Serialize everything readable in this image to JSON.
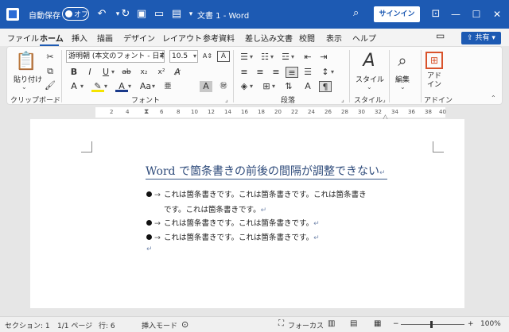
{
  "titlebar": {
    "autosave_label": "自動保存",
    "autosave_state": "オフ",
    "doc_title": "文書 1  -  Word",
    "signin_label": "サインイン",
    "icons": [
      "word-logo",
      "undo",
      "redo",
      "save",
      "new-doc",
      "open-folder",
      "customize",
      "search",
      "minimize",
      "maximize",
      "close"
    ]
  },
  "tabs": [
    "ファイル",
    "ホーム",
    "挿入",
    "描画",
    "デザイン",
    "レイアウト",
    "参考資料",
    "差し込み文書",
    "校閲",
    "表示",
    "ヘルプ"
  ],
  "active_tab": "ホーム",
  "share_label": "共有",
  "ribbon": {
    "clipboard": {
      "paste_label": "貼り付け",
      "group_label": "クリップボード"
    },
    "font": {
      "font_name": "游明朝 (本文のフォント - 日本語)",
      "font_size": "10.5",
      "group_label": "フォント",
      "buttons": [
        "B",
        "I",
        "U",
        "ab",
        "x₂",
        "x²",
        "A",
        "A",
        "A"
      ]
    },
    "paragraph": {
      "group_label": "段落"
    },
    "styles": {
      "style_label": "スタイル",
      "group_label": "スタイル"
    },
    "editing": {
      "edit_label": "編集"
    },
    "addin": {
      "addin_label": "アド\nイン",
      "group_label": "アドイン"
    }
  },
  "ruler": {
    "numbers": [
      "2",
      "4",
      "6",
      "8",
      "10",
      "12",
      "14",
      "16",
      "18",
      "20",
      "22",
      "24",
      "26",
      "28",
      "30",
      "32",
      "34",
      "36",
      "38",
      "40"
    ]
  },
  "document": {
    "title": "Word で箇条書きの前後の間隔が調整できない",
    "bullets": [
      {
        "line1": "これは箇条書きです。これは箇条書きです。これは箇条書き",
        "line2": "です。これは箇条書きです。"
      },
      {
        "line1": "これは箇条書きです。これは箇条書きです。"
      },
      {
        "line1": "これは箇条書きです。これは箇条書きです。"
      }
    ],
    "para_mark": "↵",
    "arrow": "→"
  },
  "statusbar": {
    "section": "セクション: 1",
    "page": "1/1 ページ",
    "line": "行: 6",
    "mode": "挿入モード",
    "focus": "フォーカス",
    "zoom": "100%",
    "zoom_minus": "−",
    "zoom_plus": "+"
  },
  "colors": {
    "accent": "#1d5ab3",
    "title_text": "#2d4a7a"
  }
}
